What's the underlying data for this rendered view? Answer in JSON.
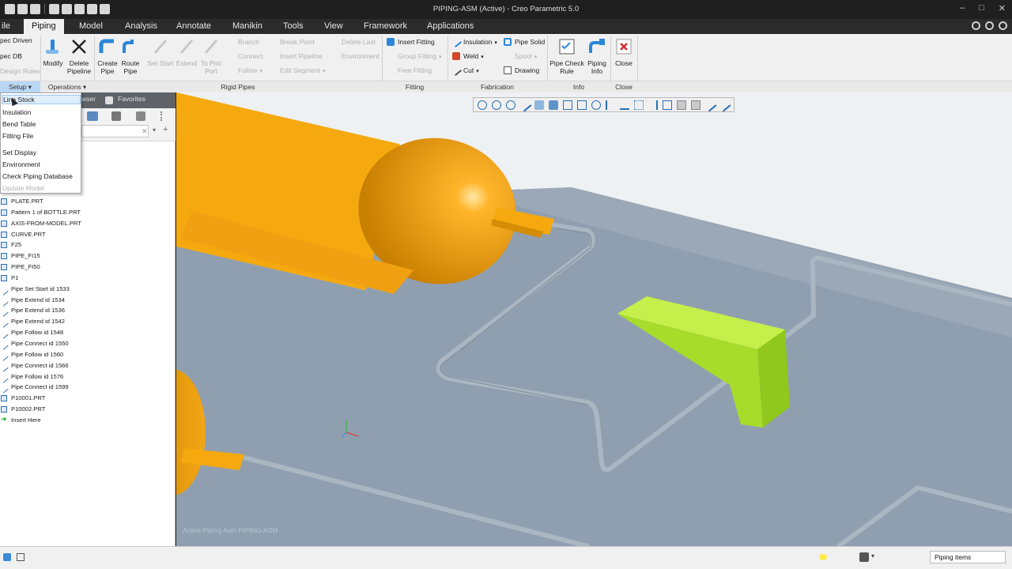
{
  "window": {
    "title": "PIPING-ASM (Active) - Creo Parametric 5.0",
    "controls": [
      "–",
      "□",
      "✕"
    ]
  },
  "tabs": [
    "ile",
    "Piping",
    "Model",
    "Analysis",
    "Annotate",
    "Manikin",
    "Tools",
    "View",
    "Framework",
    "Applications"
  ],
  "ribbon": {
    "setup_items": [
      "pec Driven",
      "pec DB",
      "Design Rules"
    ],
    "groups": [
      "Setup ▾",
      "Operations ▾",
      "Rigid Pipes",
      "Fitting",
      "Fabrication",
      "Info",
      "Close"
    ],
    "modify": "Modify",
    "delete_pipeline": "Delete\nPipeline",
    "create_pipe": "Create\nPipe",
    "route_pipe": "Route\nPipe",
    "set_start": "Set Start",
    "extend": "Extend",
    "to_pnt_port": "To Pnt/\nPort",
    "branch": "Branch",
    "connect": "Connect",
    "follow": "Follow",
    "break_point": "Break Point",
    "insert_pipeline": "Insert Pipeline",
    "edit_segment": "Edit Segment",
    "delete_last": "Delete Last",
    "environment": "Environment",
    "insert_fitting": "Insert Fitting",
    "group_fitting": "Group Fitting",
    "free_fitting": "Free Fitting",
    "insulation": "Insulation",
    "weld": "Weld",
    "cut": "Cut",
    "pipe_solid": "Pipe Solid",
    "spool": "Spool",
    "drawing": "Drawing",
    "pipe_check_rule": "Pipe Check\nRule",
    "piping_info": "Piping\nInfo",
    "close": "Close"
  },
  "panel": {
    "tabs": [
      "wser",
      "Favorites"
    ]
  },
  "dropdown": {
    "items": [
      {
        "label": "Line Stock",
        "highlight": true,
        "disabled": false
      },
      {
        "label": "Insulation",
        "highlight": false,
        "disabled": false
      },
      {
        "label": "Bend Table",
        "highlight": false,
        "disabled": false
      },
      {
        "label": "Fitting File",
        "highlight": false,
        "disabled": false
      },
      {
        "label": "Set Display",
        "highlight": false,
        "disabled": false
      },
      {
        "label": "Environment",
        "highlight": false,
        "disabled": false
      },
      {
        "label": "Check Piping Database",
        "highlight": false,
        "disabled": false
      },
      {
        "label": "Update Model",
        "highlight": false,
        "disabled": true
      }
    ]
  },
  "tree": [
    {
      "label": "PLATE.PRT",
      "kind": "part"
    },
    {
      "label": "Pattern 1 of BOTTLE.PRT",
      "kind": "part"
    },
    {
      "label": "AXIS-FROM-MODEL.PRT",
      "kind": "part"
    },
    {
      "label": "CURVE.PRT",
      "kind": "part"
    },
    {
      "label": "F25",
      "kind": "part"
    },
    {
      "label": "PIPE_FI15",
      "kind": "part"
    },
    {
      "label": "PIPE_FI50",
      "kind": "part"
    },
    {
      "label": "P1",
      "kind": "part"
    },
    {
      "label": "Pipe Set Start id 1533",
      "kind": "feature"
    },
    {
      "label": "Pipe Extend id 1534",
      "kind": "feature"
    },
    {
      "label": "Pipe Extend id 1536",
      "kind": "feature"
    },
    {
      "label": "Pipe Extend id 1542",
      "kind": "feature"
    },
    {
      "label": "Pipe Follow id 1548",
      "kind": "feature"
    },
    {
      "label": "Pipe Connect id 1550",
      "kind": "feature"
    },
    {
      "label": "Pipe Follow id 1560",
      "kind": "feature"
    },
    {
      "label": "Pipe Connect id 1566",
      "kind": "feature"
    },
    {
      "label": "Pipe Follow id 1576",
      "kind": "feature"
    },
    {
      "label": "Pipe Connect id 1599",
      "kind": "feature"
    },
    {
      "label": "P10001.PRT",
      "kind": "part"
    },
    {
      "label": "P10002.PRT",
      "kind": "part"
    },
    {
      "label": "Insert Here",
      "kind": "insert"
    }
  ],
  "viewport": {
    "message": "Active Piping Asm PIPING-ASM"
  },
  "status": {
    "filter_value": "Piping items"
  },
  "colors": {
    "tank": "#f5a90f",
    "bracket": "#a7dc2a",
    "plate": "#8f9fb0",
    "pipe": "#aab6c2"
  }
}
